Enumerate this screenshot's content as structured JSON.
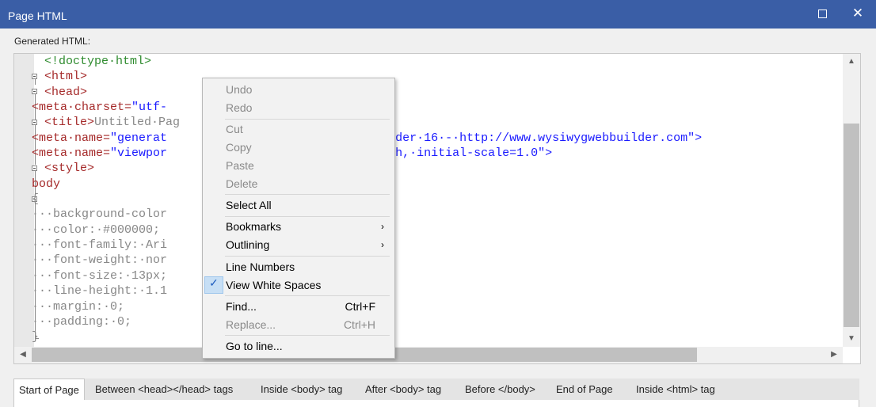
{
  "window": {
    "title": "Page HTML",
    "maximize_icon": "maximize-icon",
    "close_glyph": "✕"
  },
  "editor": {
    "label": "Generated HTML:",
    "lines": [
      [
        [
          "c-green",
          "<!doctype·html>"
        ]
      ],
      [
        [
          "c-brown",
          "<html>"
        ]
      ],
      [
        [
          "c-brown",
          "<head>"
        ]
      ],
      [
        [
          "c-brown",
          "<meta·"
        ],
        [
          "c-brown",
          "charset="
        ],
        [
          "c-blue",
          "\"utf-"
        ]
      ],
      [
        [
          "c-brown",
          "<title>"
        ],
        [
          "c-gray",
          "Untitled·Pag"
        ]
      ],
      [
        [
          "c-brown",
          "<meta·"
        ],
        [
          "c-brown",
          "name="
        ],
        [
          "c-blue",
          "\"generat"
        ],
        [
          "c-gray",
          "                          "
        ],
        [
          "c-blue",
          "b·Builder·16·-·http://www.wysiwygwebbuilder.com\">"
        ]
      ],
      [
        [
          "c-brown",
          "<meta·"
        ],
        [
          "c-brown",
          "name="
        ],
        [
          "c-blue",
          "\"viewpor"
        ],
        [
          "c-gray",
          "                          "
        ],
        [
          "c-blue",
          "e-width,·initial-scale=1.0\">"
        ]
      ],
      [
        [
          "c-brown",
          "<style>"
        ]
      ],
      [
        [
          "c-brown",
          "body"
        ]
      ],
      [
        [
          "c-gray",
          "{"
        ]
      ],
      [
        [
          "c-gray",
          "···background-color"
        ]
      ],
      [
        [
          "c-gray",
          "···color:·#000000;"
        ]
      ],
      [
        [
          "c-gray",
          "···font-family:·Ari"
        ]
      ],
      [
        [
          "c-gray",
          "···font-weight:·nor"
        ]
      ],
      [
        [
          "c-gray",
          "···font-size:·13px;"
        ]
      ],
      [
        [
          "c-gray",
          "···line-height:·1.1"
        ]
      ],
      [
        [
          "c-gray",
          "···margin:·0;"
        ]
      ],
      [
        [
          "c-gray",
          "···padding:·0;"
        ]
      ],
      [
        [
          "c-gray",
          "}"
        ]
      ]
    ]
  },
  "context_menu": {
    "items": [
      {
        "label": "Undo",
        "enabled": false
      },
      {
        "label": "Redo",
        "enabled": false
      },
      {
        "label": "Cut",
        "enabled": false
      },
      {
        "label": "Copy",
        "enabled": false
      },
      {
        "label": "Paste",
        "enabled": false
      },
      {
        "label": "Delete",
        "enabled": false
      },
      {
        "label": "Select All",
        "enabled": true
      },
      {
        "label": "Bookmarks",
        "enabled": true,
        "submenu": true
      },
      {
        "label": "Outlining",
        "enabled": true,
        "submenu": true
      },
      {
        "label": "Line Numbers",
        "enabled": true
      },
      {
        "label": "View White Spaces",
        "enabled": true,
        "checked": true
      },
      {
        "label": "Find...",
        "enabled": true,
        "shortcut": "Ctrl+F"
      },
      {
        "label": "Replace...",
        "enabled": false,
        "shortcut": "Ctrl+H"
      },
      {
        "label": "Go to line...",
        "enabled": true
      }
    ],
    "submenu_glyph": "›",
    "check_glyph": "✓"
  },
  "tabs": [
    {
      "label": "Start of Page",
      "active": true
    },
    {
      "label": "Between <head></head> tags"
    },
    {
      "label": "Inside <body> tag"
    },
    {
      "label": "After <body> tag"
    },
    {
      "label": "Before </body>"
    },
    {
      "label": "End of Page"
    },
    {
      "label": "Inside <html> tag"
    }
  ],
  "scroll_glyphs": {
    "up": "▲",
    "down": "▼",
    "left": "◀",
    "right": "▶"
  }
}
